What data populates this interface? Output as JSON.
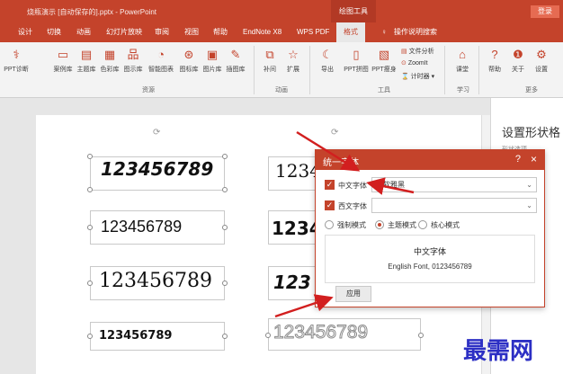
{
  "window": {
    "title": "烧瓶演示 [自动保存的].pptx - PowerPoint",
    "context_tab": "绘图工具",
    "login": "登录"
  },
  "tabs": [
    "设计",
    "切换",
    "动画",
    "幻灯片放映",
    "审阅",
    "视图",
    "帮助",
    "EndNote X8",
    "WPS PDF",
    "格式",
    "操作说明搜索"
  ],
  "ribbon": {
    "buttons": [
      "PPT诊断",
      "案例库",
      "主题库",
      "色彩库",
      "图示库",
      "智能图表",
      "图标库",
      "图片库",
      "插图库",
      "补间",
      "扩展",
      "导出",
      "PPT拼图",
      "PPT瘦身",
      "课堂",
      "帮助",
      "关于",
      "设置"
    ],
    "small_items": [
      "文件分析",
      "ZoomIt",
      "计时器"
    ],
    "groups": [
      "资源",
      "动画",
      "工具",
      "学习",
      "更多"
    ]
  },
  "slide": {
    "numbers": [
      "123456789",
      "123456789",
      "123456789",
      "123456789",
      "12345",
      "1234",
      "123",
      "123456789"
    ]
  },
  "right_panel": {
    "title": "设置形状格",
    "subtitle": "形状选项"
  },
  "dialog": {
    "title": "统一字体",
    "help_icon": "?",
    "close_icon": "×",
    "chinese_font_label": "中文字体",
    "chinese_font_value": "微软雅黑",
    "western_font_label": "西文字体",
    "western_font_value": "",
    "modes": [
      "强制模式",
      "主题模式",
      "核心模式"
    ],
    "selected_mode": "主题模式",
    "preview_line1": "中文字体",
    "preview_line2": "English Font, 0123456789",
    "apply_label": "应用"
  },
  "watermark": "最需网",
  "colors": {
    "accent": "#c4432b",
    "arrow": "#d21f1f",
    "watermark": "#2c2fc4"
  }
}
